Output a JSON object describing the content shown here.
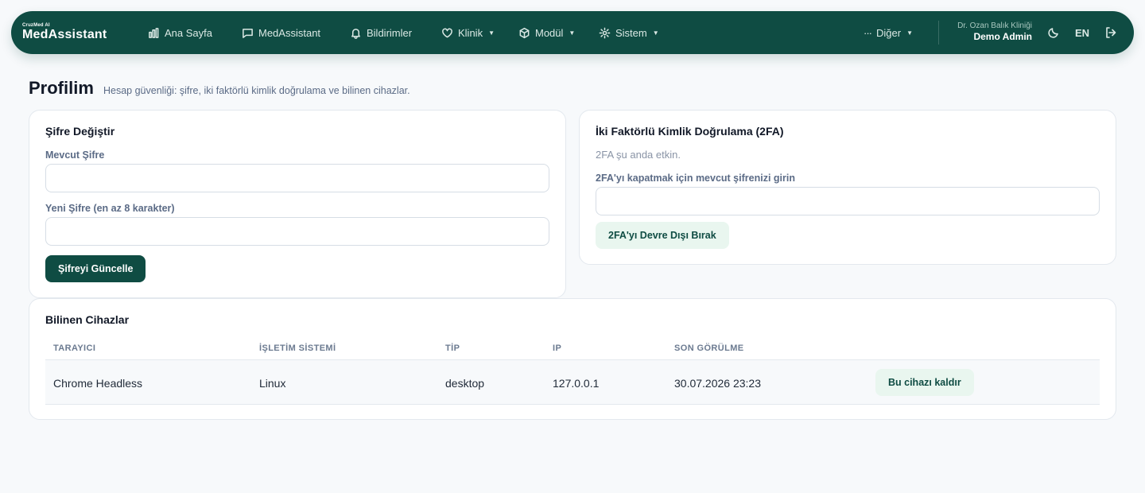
{
  "brand": {
    "small": "CruzMed AI",
    "name": "MedAssistant"
  },
  "nav": {
    "items": [
      {
        "label": "Ana Sayfa",
        "icon": "bar-chart-icon"
      },
      {
        "label": "MedAssistant",
        "icon": "chat-icon"
      },
      {
        "label": "Bildirimler",
        "icon": "bell-icon"
      },
      {
        "label": "Klinik",
        "icon": "heart-icon",
        "dropdown": true
      },
      {
        "label": "Modül",
        "icon": "cube-icon",
        "dropdown": true
      },
      {
        "label": "Sistem",
        "icon": "gear-icon",
        "dropdown": true
      }
    ],
    "more_label": "Diğer",
    "clinic": "Dr. Ozan Balık Kliniği",
    "user": "Demo Admin",
    "lang": "EN"
  },
  "page": {
    "title": "Profilim",
    "subtitle": "Hesap güvenliği: şifre, iki faktörlü kimlik doğrulama ve bilinen cihazlar."
  },
  "password_card": {
    "title": "Şifre Değiştir",
    "current_label": "Mevcut Şifre",
    "current_value": "",
    "new_label": "Yeni Şifre (en az 8 karakter)",
    "new_value": "",
    "submit_label": "Şifreyi Güncelle"
  },
  "twofa_card": {
    "title": "İki Faktörlü Kimlik Doğrulama (2FA)",
    "status": "2FA şu anda etkin.",
    "password_label": "2FA'yı kapatmak için mevcut şifrenizi girin",
    "password_value": "",
    "disable_label": "2FA'yı Devre Dışı Bırak"
  },
  "devices_card": {
    "title": "Bilinen Cihazlar",
    "columns": [
      "TARAYICI",
      "İŞLETİM SİSTEMİ",
      "TİP",
      "IP",
      "SON GÖRÜLME"
    ],
    "rows": [
      {
        "browser": "Chrome Headless",
        "os": "Linux",
        "type": "desktop",
        "ip": "127.0.0.1",
        "last_seen": "30.07.2026 23:23",
        "action": "Bu cihazı kaldır"
      }
    ]
  },
  "colors": {
    "primary": "#0f4c43",
    "soft": "#e9f6ef",
    "background": "#f7f9fb"
  }
}
